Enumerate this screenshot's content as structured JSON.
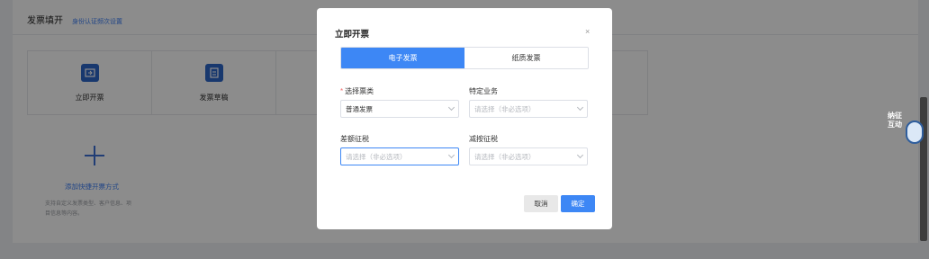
{
  "page": {
    "title": "发票填开",
    "link": "身份认证频次设置",
    "cards": [
      {
        "label": "立即开票",
        "icon": "invoice-icon"
      },
      {
        "label": "发票草稿",
        "icon": "draft-icon"
      },
      {
        "label": "",
        "icon": ""
      },
      {
        "label": "",
        "icon": ""
      },
      {
        "label": "",
        "icon": ""
      }
    ],
    "add_label": "添加快捷开票方式",
    "add_desc": "支持自定义发票类型、客户信息、项目信息等内容。"
  },
  "assistant": {
    "text": "纳征互动"
  },
  "modal": {
    "title": "立即开票",
    "close": "×",
    "tabs": [
      {
        "label": "电子发票",
        "active": true
      },
      {
        "label": "纸质发票",
        "active": false
      }
    ],
    "fields": {
      "invoice_type": {
        "label": "选择票类",
        "required": "*",
        "value": "普通发票"
      },
      "special_business": {
        "label": "特定业务",
        "placeholder": "请选择（非必选项）"
      },
      "differential_tax": {
        "label": "差额征税",
        "placeholder": "请选择（非必选项）"
      },
      "reduced_tax": {
        "label": "减按征税",
        "placeholder": "请选择（非必选项）"
      }
    },
    "cancel": "取消",
    "confirm": "确定"
  },
  "colors": {
    "accent": "#3d87f5",
    "overlay": "rgba(0,0,0,0.45)"
  }
}
